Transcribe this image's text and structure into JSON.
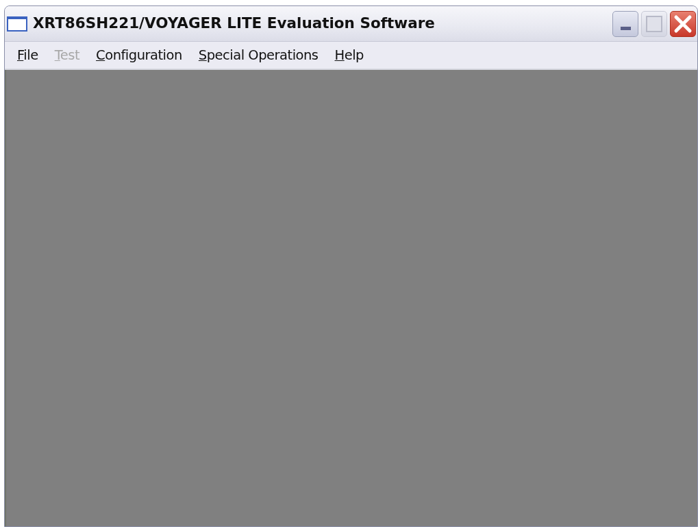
{
  "window": {
    "title": "XRT86SH221/VOYAGER LITE Evaluation Software"
  },
  "menu": [
    {
      "label": "File",
      "access_key_underlined": true,
      "disabled": false
    },
    {
      "label": "Test",
      "access_key_underlined": true,
      "disabled": true
    },
    {
      "label": "Configuration",
      "access_key_underlined": true,
      "disabled": false
    },
    {
      "label": "Special Operations",
      "access_key_underlined": true,
      "disabled": false
    },
    {
      "label": "Help",
      "access_key_underlined": true,
      "disabled": false
    }
  ]
}
